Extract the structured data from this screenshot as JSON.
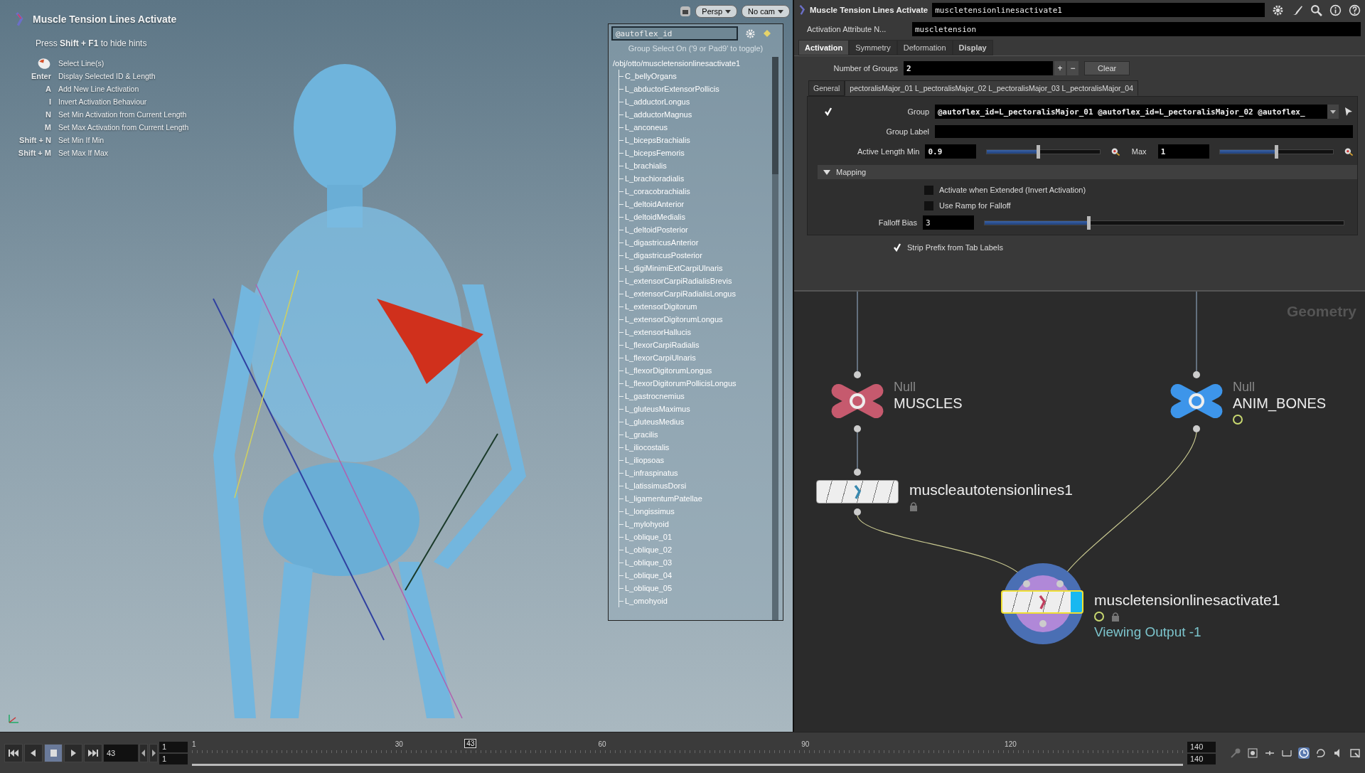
{
  "viewport": {
    "toolbar": [
      {
        "label": "Persp"
      },
      {
        "label": "No cam"
      }
    ],
    "hints": {
      "title": "Muscle Tension Lines Activate",
      "subtitle": "Press **Shift + F1** to hide hints",
      "items": [
        {
          "kind": "mouse",
          "text": "Select Line(s)"
        },
        {
          "kind": "key",
          "key": "Enter",
          "text": "Display Selected ID & Length"
        },
        {
          "kind": "key",
          "key": "A",
          "text": "Add New Line Activation"
        },
        {
          "kind": "key",
          "key": "I",
          "text": "Invert Activation Behaviour"
        },
        {
          "kind": "key",
          "key": "N",
          "text": "Set Min Activation from Current Length"
        },
        {
          "kind": "key",
          "key": "M",
          "text": "Set Max Activation from Current Length"
        },
        {
          "kind": "key",
          "key": "Shift + N",
          "text": "Set Min If Min"
        },
        {
          "kind": "key",
          "key": "Shift + M",
          "text": "Set Max If Max"
        }
      ]
    },
    "group_list": {
      "filter": "@autoflex_id",
      "status": "Group Select On ('9 or Pad9' to toggle)",
      "tree": {
        "label": "/obj/otto/muscletensionlinesactivate1",
        "children": [
          {
            "label": "C_bellyOrgans"
          },
          {
            "label": "L_abductorExtensorPollicis"
          },
          {
            "label": "L_adductorLongus"
          },
          {
            "label": "L_adductorMagnus"
          },
          {
            "label": "L_anconeus"
          },
          {
            "label": "L_bicepsBrachialis"
          },
          {
            "label": "L_bicepsFemoris"
          },
          {
            "label": "L_brachialis"
          },
          {
            "label": "L_brachioradialis"
          },
          {
            "label": "L_coracobrachialis"
          },
          {
            "label": "L_deltoidAnterior"
          },
          {
            "label": "L_deltoidMedialis"
          },
          {
            "label": "L_deltoidPosterior"
          },
          {
            "label": "L_digastricusAnterior"
          },
          {
            "label": "L_digastricusPosterior"
          },
          {
            "label": "L_digiMinimiExtCarpiUlnaris"
          },
          {
            "label": "L_extensorCarpiRadialisBrevis"
          },
          {
            "label": "L_extensorCarpiRadialisLongus"
          },
          {
            "label": "L_extensorDigitorum"
          },
          {
            "label": "L_extensorDigitorumLongus"
          },
          {
            "label": "L_extensorHallucis"
          },
          {
            "label": "L_flexorCarpiRadialis"
          },
          {
            "label": "L_flexorCarpiUlnaris"
          },
          {
            "label": "L_flexorDigitorumLongus"
          },
          {
            "label": "L_flexorDigitorumPollicisLongus"
          },
          {
            "label": "L_gastrocnemius"
          },
          {
            "label": "L_gluteusMaximus"
          },
          {
            "label": "L_gluteusMedius"
          },
          {
            "label": "L_gracilis"
          },
          {
            "label": "L_iliocostalis"
          },
          {
            "label": "L_iliopsoas"
          },
          {
            "label": "L_infraspinatus"
          },
          {
            "label": "L_latissimusDorsi"
          },
          {
            "label": "L_ligamentumPatellae"
          },
          {
            "label": "L_longissimus"
          },
          {
            "label": "L_mylohyoid"
          },
          {
            "label": "L_oblique_01"
          },
          {
            "label": "L_oblique_02"
          },
          {
            "label": "L_oblique_03"
          },
          {
            "label": "L_oblique_04"
          },
          {
            "label": "L_oblique_05"
          },
          {
            "label": "L_omohyoid"
          }
        ]
      }
    }
  },
  "parameters": {
    "node_type": "Muscle Tension Lines Activate",
    "node_name": "muscletensionlinesactivate1",
    "attribute": {
      "label": "Activation Attribute N...",
      "value": "muscletension"
    },
    "tabs": [
      {
        "label": "Activation",
        "selected": true,
        "modified": true
      },
      {
        "label": "Symmetry",
        "selected": false,
        "modified": false
      },
      {
        "label": "Deformation",
        "selected": false,
        "modified": false
      },
      {
        "label": "Display",
        "selected": false,
        "modified": true
      }
    ],
    "groups": {
      "label": "Number of Groups",
      "value": "2",
      "plus": "+",
      "minus": "−",
      "clear": "Clear"
    },
    "group_tabs": [
      {
        "label": "General",
        "selected": false
      },
      {
        "label": "pectoralisMajor_01 L_pectoralisMajor_02 L_pectoralisMajor_03 L_pectoralisMajor_04",
        "selected": true
      }
    ],
    "group": {
      "enabled": true,
      "label": "Group",
      "value": "@autoflex_id=L_pectoralisMajor_01 @autoflex_id=L_pectoralisMajor_02 @autoflex_"
    },
    "group_label": {
      "label": "Group Label"
    },
    "length": {
      "label": "Active Length Min",
      "min": {
        "value": "0.9",
        "level": 0.45
      },
      "max_label": "Max",
      "max": {
        "value": "1",
        "level": 0.5
      }
    },
    "mapping": {
      "label": "Mapping",
      "expanded": true,
      "options": [
        {
          "label": "Activate when Extended (Invert Activation)",
          "checked": false
        },
        {
          "label": "Use Ramp for Falloff",
          "checked": false
        }
      ],
      "falloff": {
        "label": "Falloff Bias",
        "value": "3",
        "level": 0.29
      }
    },
    "strip_prefix": {
      "label": "Strip Prefix from Tab Labels",
      "checked": true
    }
  },
  "network": {
    "context": "Geometry",
    "nodes": [
      {
        "kind": "null",
        "type": "Null",
        "name": "MUSCLES",
        "color": "#c65a6e"
      },
      {
        "kind": "null",
        "type": "Null",
        "name": "ANIM_BONES",
        "color": "#3d95ea",
        "badges": [
          {
            "kind": "clock"
          }
        ]
      },
      {
        "kind": "sop",
        "name": "muscleautotensionlines1",
        "selected": false,
        "display": false,
        "badges": [
          {
            "kind": "lock"
          }
        ]
      },
      {
        "kind": "sop",
        "name": "muscletensionlinesactivate1",
        "selected": true,
        "display": true,
        "badges": [
          {
            "kind": "clock"
          },
          {
            "kind": "lock"
          }
        ],
        "status": "Viewing Output -1"
      }
    ]
  },
  "timeline": {
    "frame": "43",
    "start": "1",
    "start_2": "1",
    "end": "140",
    "end_2": "140",
    "ticks": [
      "1",
      "30",
      "60",
      "90",
      "120"
    ],
    "current": "43"
  }
}
